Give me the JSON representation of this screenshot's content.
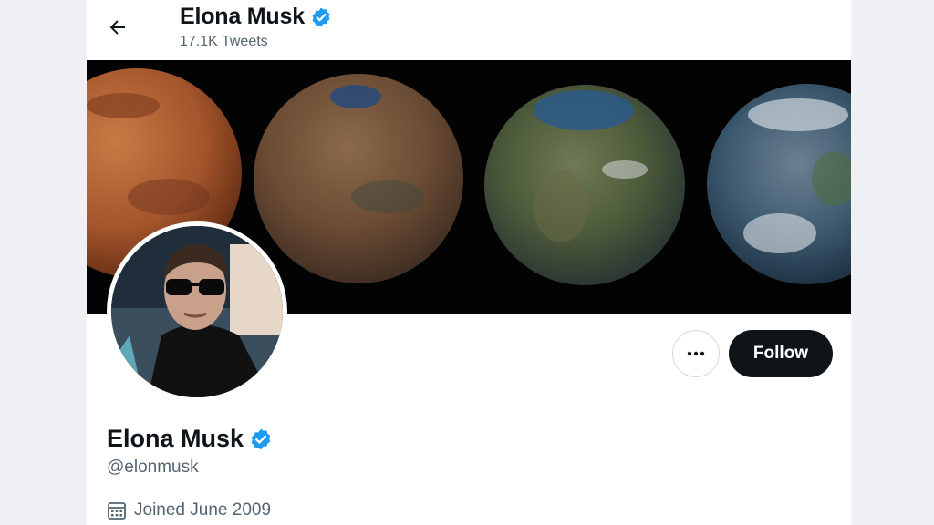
{
  "header": {
    "name": "Elona Musk",
    "tweet_count": "17.1K Tweets"
  },
  "profile": {
    "name": "Elona Musk",
    "handle": "@elonmusk",
    "joined": "Joined June 2009"
  },
  "actions": {
    "follow_label": "Follow"
  },
  "icons": {
    "back": "arrow-left-icon",
    "verified": "verified-badge-icon",
    "more": "more-dots-icon",
    "calendar": "calendar-icon"
  },
  "colors": {
    "verified_blue": "#1d9bf0",
    "follow_bg": "#0f1419",
    "muted_text": "#536471"
  }
}
